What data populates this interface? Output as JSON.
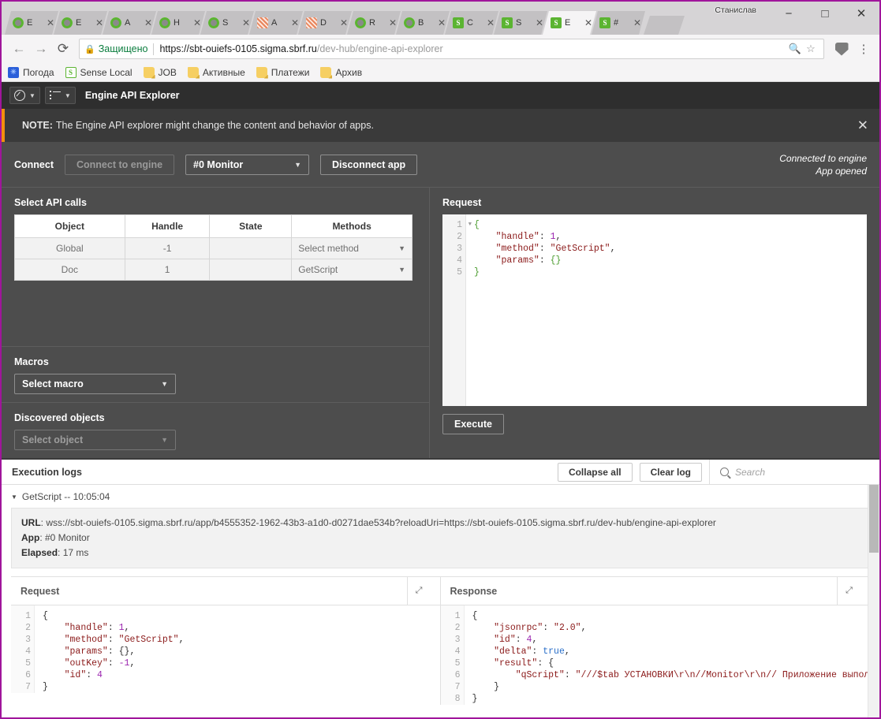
{
  "browser": {
    "user_badge": "Станислав",
    "window_controls": {
      "minimize": "−",
      "maximize": "□",
      "close": "✕"
    },
    "tabs": [
      {
        "favicon": "qlik-icon",
        "label": "E",
        "close": "✕",
        "active": false
      },
      {
        "favicon": "qlik-icon",
        "label": "E",
        "close": "✕",
        "active": false
      },
      {
        "favicon": "qlik-icon",
        "label": "A",
        "close": "✕",
        "active": false
      },
      {
        "favicon": "qlik-icon",
        "label": "H",
        "close": "✕",
        "active": false
      },
      {
        "favicon": "qlik-icon",
        "label": "S",
        "close": "✕",
        "active": false
      },
      {
        "favicon": "grid-icon",
        "label": "A",
        "close": "✕",
        "active": false
      },
      {
        "favicon": "grid-icon",
        "label": "D",
        "close": "✕",
        "active": false
      },
      {
        "favicon": "qlik-icon",
        "label": "R",
        "close": "✕",
        "active": false
      },
      {
        "favicon": "qlik-icon",
        "label": "B",
        "close": "✕",
        "active": false
      },
      {
        "favicon": "sense-icon",
        "label": "C",
        "close": "✕",
        "active": false
      },
      {
        "favicon": "sense-icon",
        "label": "S",
        "close": "✕",
        "active": false
      },
      {
        "favicon": "sense-icon",
        "label": "E",
        "close": "✕",
        "active": true
      },
      {
        "favicon": "sense-icon",
        "label": "#",
        "close": "✕",
        "active": false
      }
    ],
    "toolbar": {
      "back": "←",
      "forward": "→",
      "reload": "⟳",
      "security_label": "Защищено",
      "url_host": "https://sbt-ouiefs-0105.sigma.sbrf.ru",
      "url_path": "/dev-hub/engine-api-explorer",
      "zoom_icon": "🔍",
      "star_icon": "☆",
      "menu_icon": "⋮"
    },
    "bookmarks": [
      {
        "icon": "weather-icon",
        "label": "Погода"
      },
      {
        "icon": "sense-icon",
        "label": "Sense Local"
      },
      {
        "icon": "folder-icon",
        "label": "JOB"
      },
      {
        "icon": "folder-icon",
        "label": "Активные"
      },
      {
        "icon": "folder-icon",
        "label": "Платежи"
      },
      {
        "icon": "folder-icon",
        "label": "Архив"
      }
    ]
  },
  "app": {
    "title": "Engine API Explorer",
    "note": {
      "prefix": "NOTE:",
      "text": "The Engine API explorer might change the content and behavior of apps.",
      "close": "✕"
    },
    "connect": {
      "label": "Connect",
      "connect_button": "Connect to engine",
      "app_select": "#0 Monitor",
      "disconnect_button": "Disconnect app",
      "status_line1": "Connected to engine",
      "status_line2": "App opened"
    },
    "api_calls": {
      "title": "Select API calls",
      "columns": [
        "Object",
        "Handle",
        "State",
        "Methods"
      ],
      "rows": [
        {
          "object": "Global",
          "handle": "-1",
          "state": "",
          "method": "Select method"
        },
        {
          "object": "Doc",
          "handle": "1",
          "state": "",
          "method": "GetScript"
        }
      ]
    },
    "macros": {
      "title": "Macros",
      "select": "Select macro"
    },
    "discovered": {
      "title": "Discovered objects",
      "select": "Select object"
    },
    "request": {
      "title": "Request",
      "lines": [
        "1",
        "2",
        "3",
        "4",
        "5"
      ],
      "code": "{\n    \"handle\": 1,\n    \"method\": \"GetScript\",\n    \"params\": {}\n}"
    },
    "execute_button": "Execute"
  },
  "logs": {
    "title": "Execution logs",
    "collapse_button": "Collapse all",
    "clear_button": "Clear log",
    "search_placeholder": "Search",
    "entry": {
      "caret": "▼",
      "header": "GetScript -- 10:05:04",
      "url_label": "URL",
      "url_value": "wss://sbt-ouiefs-0105.sigma.sbrf.ru/app/b4555352-1962-43b3-a1d0-d0271dae534b?reloadUri=https://sbt-ouiefs-0105.sigma.sbrf.ru/dev-hub/engine-api-explorer",
      "app_label": "App",
      "app_value": "#0 Monitor",
      "elapsed_label": "Elapsed",
      "elapsed_value": "17 ms"
    },
    "request_pane": {
      "title": "Request",
      "lines": [
        "1",
        "2",
        "3",
        "4",
        "5",
        "6",
        "7"
      ],
      "code": "{\n    \"handle\": 1,\n    \"method\": \"GetScript\",\n    \"params\": {},\n    \"outKey\": -1,\n    \"id\": 4\n}"
    },
    "response_pane": {
      "title": "Response",
      "lines": [
        "1",
        "2",
        "3",
        "4",
        "5",
        "6",
        "7",
        "8"
      ],
      "code": "{\n    \"jsonrpc\": \"2.0\",\n    \"id\": 4,\n    \"delta\": true,\n    \"result\": {\n        \"qScript\": \"///$tab УСТАНОВКИ\\r\\n//Monitor\\r\\n// Приложение выполняет\n    }\n}"
    }
  },
  "colors": {
    "window_border": "#a0159b",
    "accent_orange": "#f3900d",
    "qlik_green": "#5bb431",
    "dark_bg": "#4d4d4d"
  }
}
